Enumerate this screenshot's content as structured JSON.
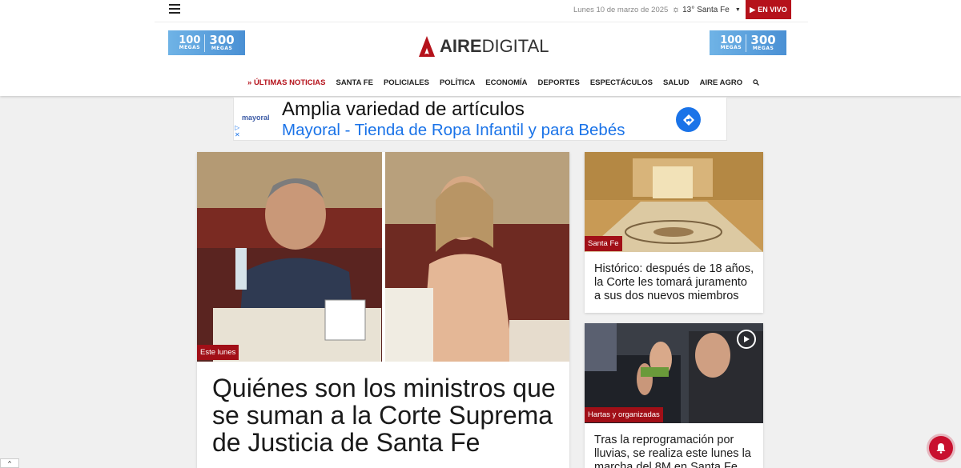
{
  "header": {
    "menu_icon": "hamburger-icon",
    "date": "Lunes 10 de marzo de 2025",
    "weather": {
      "icon": "sun-icon",
      "temp": "13°",
      "city": "Santa Fe"
    },
    "live_label": "EN VIVO",
    "live_color": "#b5121b",
    "banner": {
      "small_num": "100",
      "big_num": "300",
      "unit": "MEGAS"
    },
    "logo": {
      "bold": "AIRE",
      "light": "DIGITAL",
      "color": "#b5121b"
    }
  },
  "nav": {
    "items": [
      {
        "label": "ÚLTIMAS NOTICIAS",
        "icon": "double-chevron-icon"
      },
      {
        "label": "SANTA FE"
      },
      {
        "label": "POLICIALES"
      },
      {
        "label": "POLÍTICA"
      },
      {
        "label": "ECONOMÍA"
      },
      {
        "label": "DEPORTES"
      },
      {
        "label": "ESPECTÁCULOS"
      },
      {
        "label": "SALUD"
      },
      {
        "label": "AIRE AGRO"
      }
    ],
    "search_icon": "search-icon"
  },
  "ad": {
    "brand": "mayoral",
    "line1": "Amplia variedad de artículos",
    "line2": "Mayoral - Tienda de Ropa Infantil y para Bebés",
    "arrow_icon": "directions-arrow-icon"
  },
  "main_story": {
    "tag": "Este lunes",
    "title": "Quiénes son los ministros que se suman a la Corte Suprema de Justicia de Santa Fe"
  },
  "side_stories": [
    {
      "tag": "Santa Fe",
      "title": "Histórico: después de 18 años, la Corte les tomará juramento a sus dos nuevos miembros"
    },
    {
      "tag": "Hartas y organizadas",
      "title": "Tras la reprogramación por lluvias, se realiza este lunes la marcha del 8M en Santa Fe",
      "play_icon": "play-icon"
    }
  ]
}
